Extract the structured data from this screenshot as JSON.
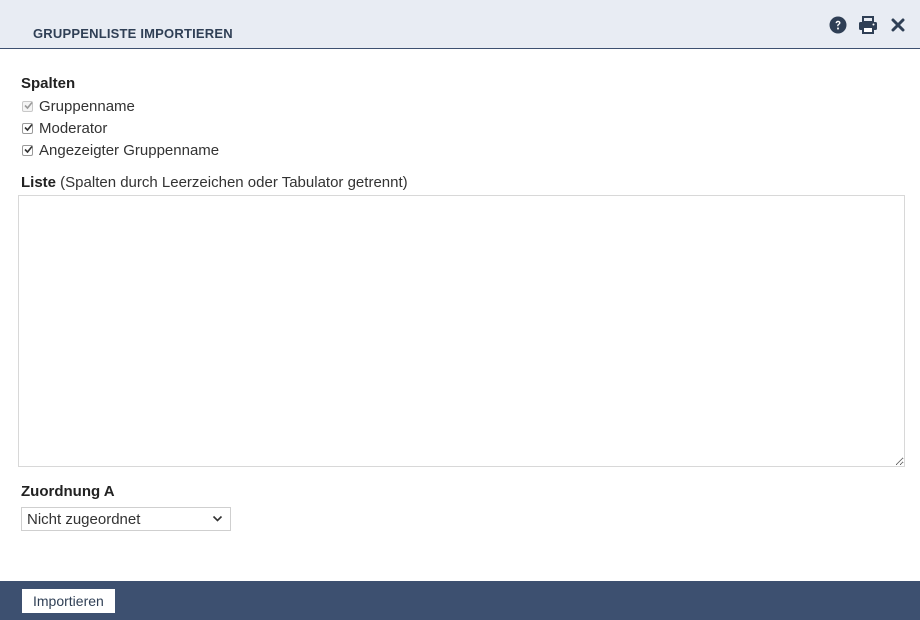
{
  "dialog": {
    "title": "GRUPPENLISTE IMPORTIEREN",
    "icons": [
      "help-icon",
      "print-icon",
      "close-icon"
    ]
  },
  "columns": {
    "label": "Spalten",
    "items": [
      {
        "label": "Gruppenname",
        "checked": true,
        "disabled": true
      },
      {
        "label": "Moderator",
        "checked": true,
        "disabled": false
      },
      {
        "label": "Angezeigter Gruppenname",
        "checked": true,
        "disabled": false
      }
    ]
  },
  "list": {
    "label": "Liste",
    "hint": " (Spalten durch Leerzeichen oder Tabulator getrennt)",
    "value": ""
  },
  "assignment": {
    "label": "Zuordnung A",
    "selected": "Nicht zugeordnet"
  },
  "footer": {
    "import_label": "Importieren"
  },
  "colors": {
    "header_bg": "#e8ecf3",
    "accent": "#3d5070",
    "title": "#2f3f55"
  }
}
